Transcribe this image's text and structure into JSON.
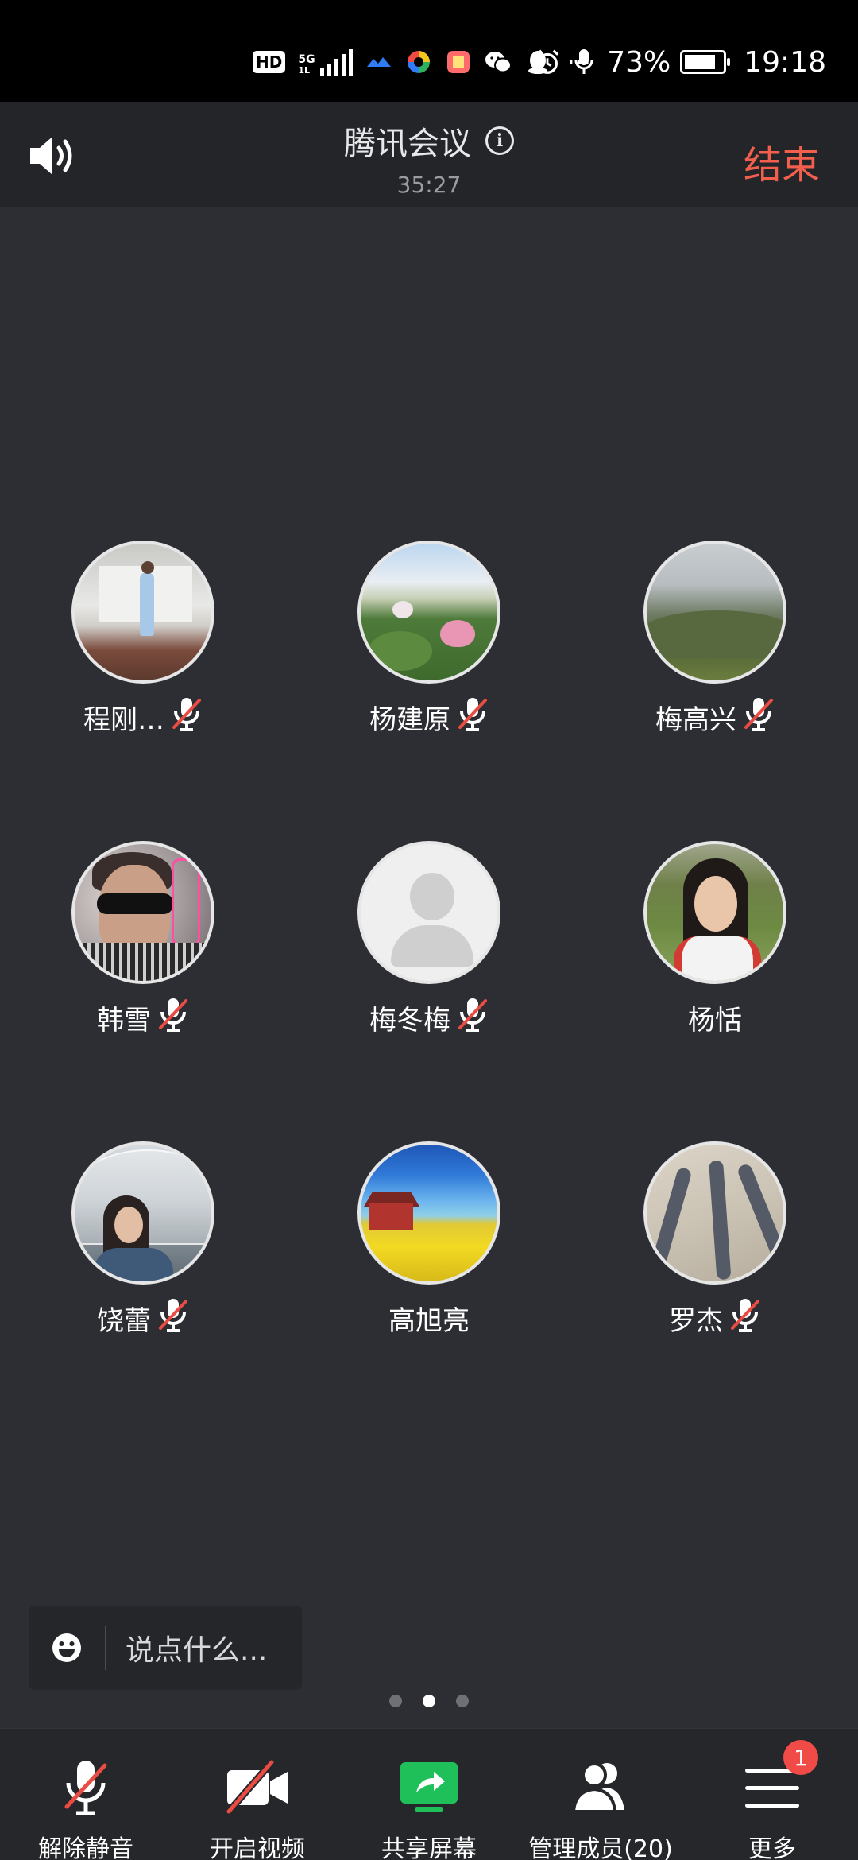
{
  "status_bar": {
    "hd": "HD",
    "network_5g": "5G",
    "network_sub": "1L",
    "dots": "···",
    "battery": "73%",
    "time": "19:18",
    "battery_level": 0.73
  },
  "header": {
    "title": "腾讯会议",
    "info": "i",
    "timer": "35:27",
    "end_label": "结束"
  },
  "participants": [
    {
      "name": "程刚…",
      "muted": true
    },
    {
      "name": "杨建原",
      "muted": true
    },
    {
      "name": "梅高兴",
      "muted": true
    },
    {
      "name": "韩雪",
      "muted": true
    },
    {
      "name": "梅冬梅",
      "muted": true
    },
    {
      "name": "杨恬",
      "muted": false
    },
    {
      "name": "饶蕾",
      "muted": true
    },
    {
      "name": "高旭亮",
      "muted": false
    },
    {
      "name": "罗杰",
      "muted": true
    }
  ],
  "chat": {
    "placeholder": "说点什么..."
  },
  "pager": {
    "count": 3,
    "active_index": 1
  },
  "bottom_bar": {
    "unmute": "解除静音",
    "video": "开启视频",
    "share": "共享屏幕",
    "members": "管理成员(20)",
    "more": "更多",
    "more_badge": "1"
  },
  "colors": {
    "end": "#f25f4c",
    "share_green": "#1fbf5a",
    "muted_red": "#e84c43",
    "badge": "#f04b46"
  }
}
